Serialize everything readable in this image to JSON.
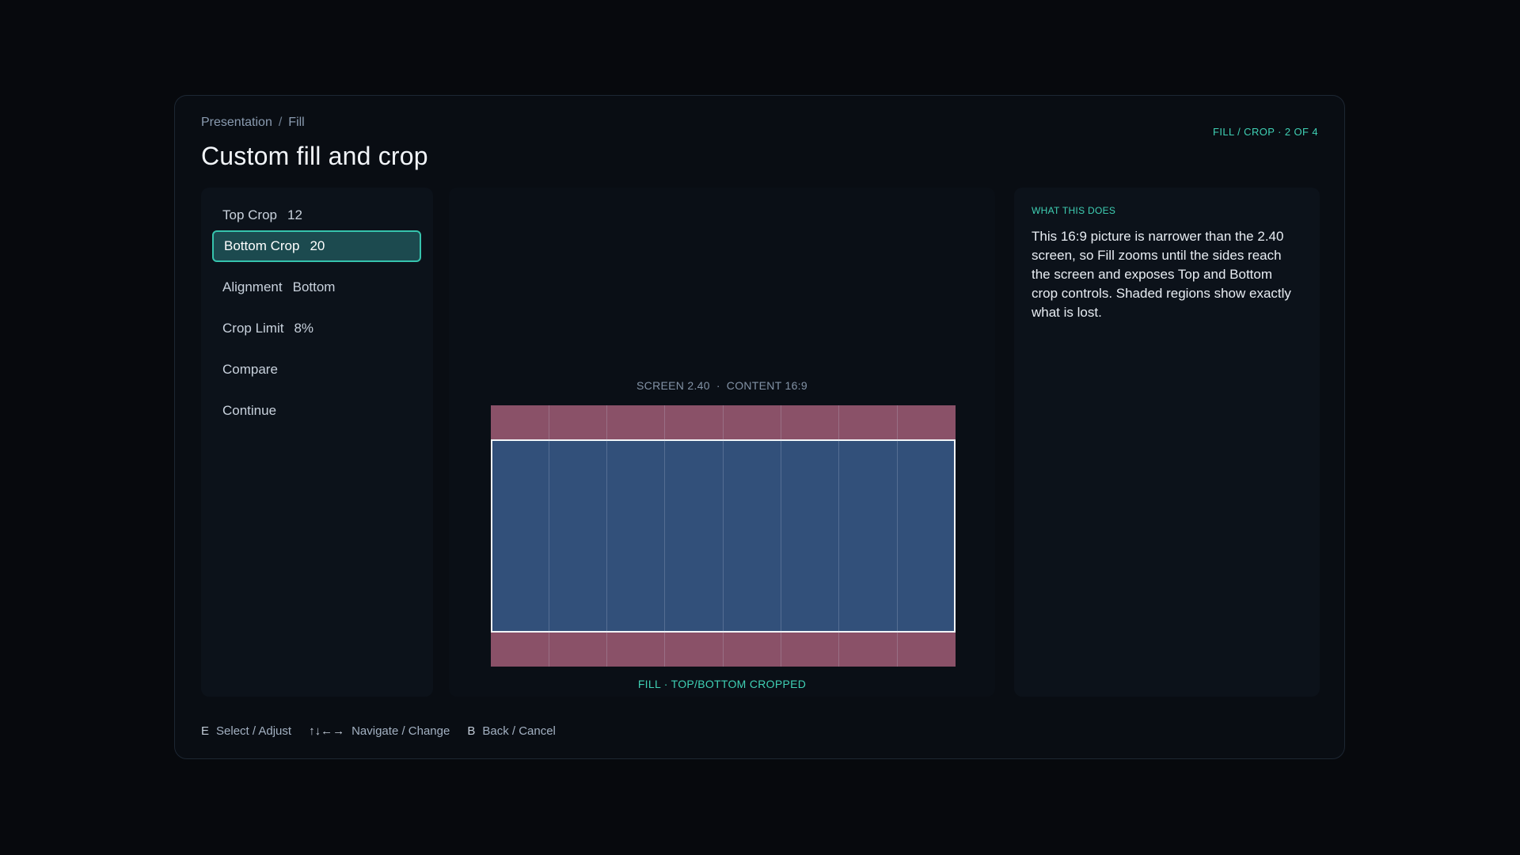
{
  "breadcrumb": {
    "parent": "Presentation",
    "separator": "/",
    "current": "Fill"
  },
  "page_title": "Custom fill and crop",
  "step_indicator": "FILL / CROP · 2 OF 4",
  "menu": {
    "items": [
      {
        "label": "Top Crop",
        "value": "12",
        "selected": false
      },
      {
        "label": "Bottom Crop",
        "value": "20",
        "selected": true
      },
      {
        "label": "Alignment",
        "value": "Bottom",
        "selected": false
      },
      {
        "label": "Crop Limit",
        "value": "8%",
        "selected": false
      },
      {
        "label": "Compare",
        "value": "",
        "selected": false
      },
      {
        "label": "Continue",
        "value": "",
        "selected": false
      }
    ]
  },
  "preview": {
    "screen_label": "SCREEN 2.40",
    "separator": "·",
    "content_label": "CONTENT 16:9",
    "result_label": "FILL · TOP/BOTTOM CROPPED"
  },
  "info": {
    "heading": "WHAT THIS DOES",
    "body": "This 16:9 picture is narrower than the 2.40 screen, so Fill zooms until the sides reach the screen and exposes Top and Bottom crop controls. Shaded regions show exactly what is lost."
  },
  "hints": [
    {
      "key": "E",
      "label": "Select / Adjust"
    },
    {
      "key": "↑↓←→",
      "label": "Navigate / Change"
    },
    {
      "key": "B",
      "label": "Back / Cancel"
    }
  ],
  "colors": {
    "accent": "#3fd0b4",
    "cropped_region": "#8a5168",
    "visible_region": "#32507a",
    "selected_bg": "#1c4a4f"
  }
}
